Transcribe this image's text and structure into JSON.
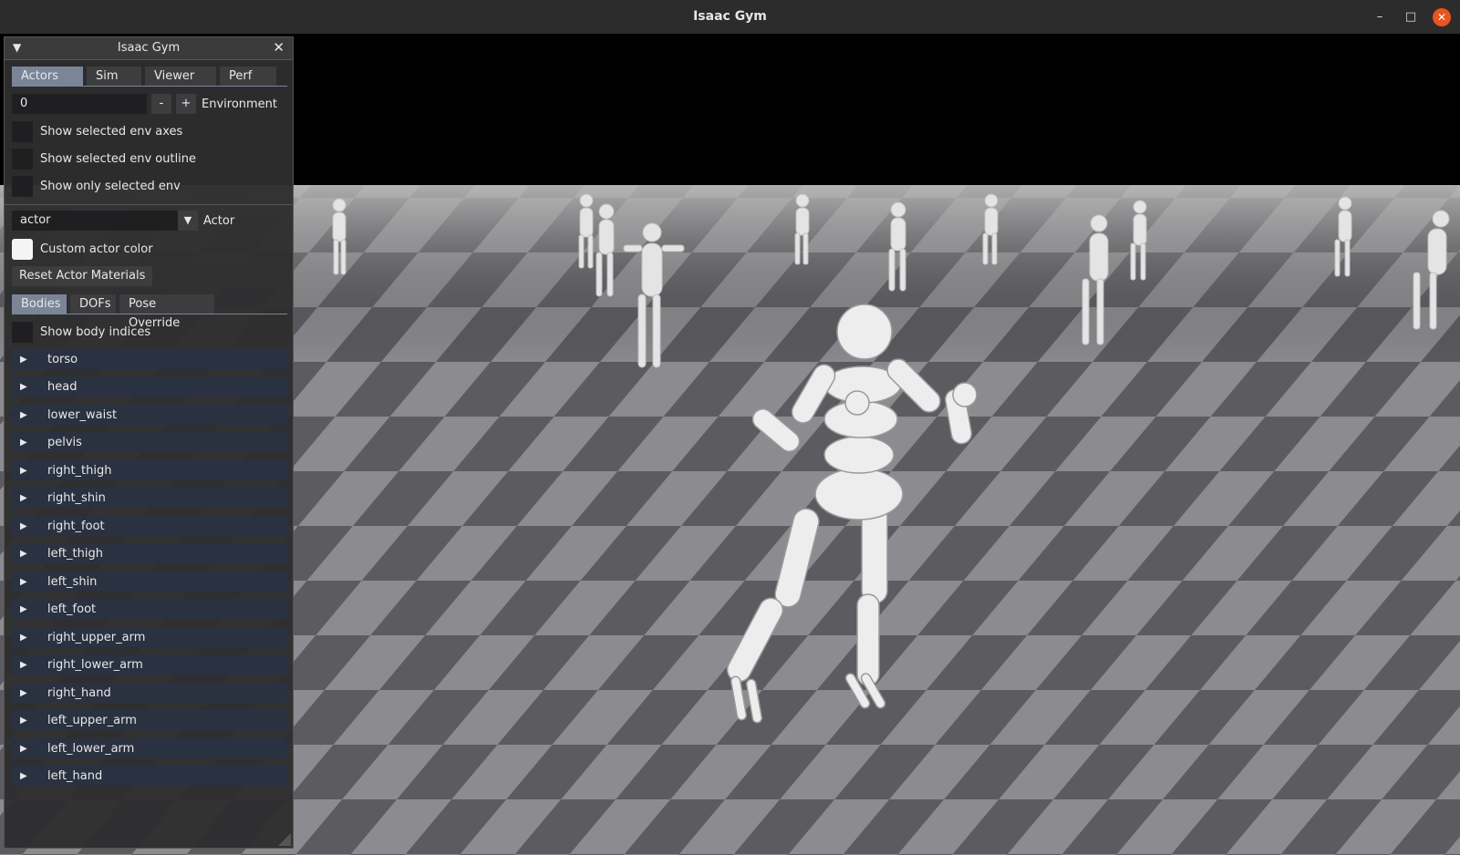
{
  "window": {
    "title": "Isaac Gym",
    "controls": {
      "minimize": "–",
      "maximize": "□",
      "close": "✕"
    }
  },
  "panel": {
    "title": "Isaac Gym",
    "collapse_glyph": "▼",
    "close_glyph": "✕",
    "tabs": [
      {
        "label": "Actors",
        "active": true
      },
      {
        "label": "Sim",
        "active": false
      },
      {
        "label": "Viewer",
        "active": false
      },
      {
        "label": "Perf",
        "active": false
      }
    ],
    "environment": {
      "value": "0",
      "minus": "-",
      "plus": "+",
      "label": "Environment"
    },
    "env_options": [
      {
        "label": "Show selected env axes",
        "checked": false
      },
      {
        "label": "Show selected env outline",
        "checked": false
      },
      {
        "label": "Show only selected env",
        "checked": false
      }
    ],
    "actor": {
      "value": "actor",
      "label": "Actor",
      "arrow": "▼"
    },
    "custom_color": {
      "label": "Custom actor color"
    },
    "reset_button": "Reset Actor Materials",
    "subtabs": [
      {
        "label": "Bodies",
        "active": true
      },
      {
        "label": "DOFs",
        "active": false
      },
      {
        "label": "Pose Override",
        "active": false
      }
    ],
    "show_body_indices": {
      "label": "Show body indices",
      "checked": false
    },
    "tree_arrow": "▶",
    "bodies": [
      "torso",
      "head",
      "lower_waist",
      "pelvis",
      "right_thigh",
      "right_shin",
      "right_foot",
      "left_thigh",
      "left_shin",
      "left_foot",
      "right_upper_arm",
      "right_lower_arm",
      "right_hand",
      "left_upper_arm",
      "left_lower_arm",
      "left_hand"
    ]
  },
  "colors": {
    "accent": "#7a8598",
    "tree_item_bg": "#2a3140",
    "close_button": "#e95420",
    "floor_dark": "#5b5b60",
    "floor_light": "#8c8c90"
  }
}
